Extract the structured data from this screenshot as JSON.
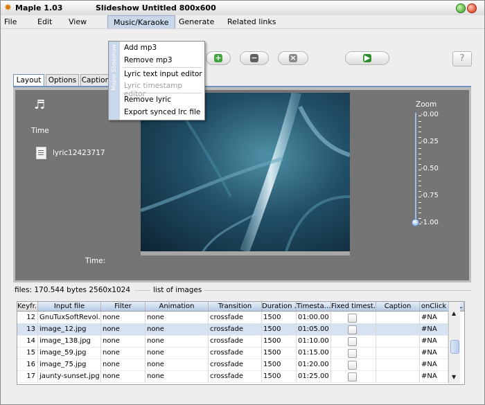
{
  "window": {
    "app_title": "Maple 1.03",
    "doc_title": "Slideshow Untitled 800x600"
  },
  "menubar": {
    "items": [
      {
        "label": "File"
      },
      {
        "label": "Edit"
      },
      {
        "label": "View"
      },
      {
        "label": "Music/Karaoke"
      },
      {
        "label": "Generate"
      },
      {
        "label": "Related links"
      }
    ]
  },
  "dropdown": {
    "side_label": "Maple Slideshow",
    "items": [
      {
        "label": "Add mp3",
        "enabled": true
      },
      {
        "label": "Remove mp3",
        "enabled": true
      },
      {
        "label": "Lyric text input editor",
        "enabled": true
      },
      {
        "label": "Lyric timestamp editor",
        "enabled": false
      },
      {
        "label": "Remove lyric",
        "enabled": true
      },
      {
        "label": "Export synced lrc file",
        "enabled": true
      }
    ]
  },
  "toolbar": {
    "help_icon": "?"
  },
  "tabs": [
    {
      "label": "Layout",
      "active": true
    },
    {
      "label": "Options",
      "active": false
    },
    {
      "label": "Caption",
      "active": false
    }
  ],
  "layout_panel": {
    "time_label": "Time",
    "lyric_file": "lyric12423717",
    "time_bottom_label": "Time:",
    "zoom": {
      "label": "Zoom",
      "ticks": [
        "-0.00",
        "-0.25",
        "-0.50",
        "-0.75",
        "-1.00"
      ],
      "value": 1.0
    }
  },
  "files": {
    "info": "files: 170.544 bytes 2560x1024",
    "list_label": "list of images"
  },
  "table": {
    "columns": [
      "Keyfr...",
      "Input file",
      "Filter",
      "Animation",
      "Transition",
      "Duration ...",
      "Timesta...",
      "Fixed timest...",
      "Caption",
      "onClick URL"
    ],
    "rows": [
      {
        "keyframe": "12",
        "file": "GnuTuxSoftRevol...",
        "filter": "none",
        "animation": "none",
        "transition": "crossfade",
        "duration": "1500",
        "timestamp": "01:00.00",
        "caption": "",
        "url": "#NA",
        "selected": false
      },
      {
        "keyframe": "13",
        "file": "image_12.jpg",
        "filter": "none",
        "animation": "none",
        "transition": "crossfade",
        "duration": "1500",
        "timestamp": "01:05.00",
        "caption": "",
        "url": "#NA",
        "selected": true
      },
      {
        "keyframe": "14",
        "file": "image_138.jpg",
        "filter": "none",
        "animation": "none",
        "transition": "crossfade",
        "duration": "1500",
        "timestamp": "01:10.00",
        "caption": "",
        "url": "#NA",
        "selected": false
      },
      {
        "keyframe": "15",
        "file": "image_59.jpg",
        "filter": "none",
        "animation": "none",
        "transition": "crossfade",
        "duration": "1500",
        "timestamp": "01:15.00",
        "caption": "",
        "url": "#NA",
        "selected": false
      },
      {
        "keyframe": "16",
        "file": "image_75.jpg",
        "filter": "none",
        "animation": "none",
        "transition": "crossfade",
        "duration": "1500",
        "timestamp": "01:20.00",
        "caption": "",
        "url": "#NA",
        "selected": false
      },
      {
        "keyframe": "17",
        "file": "jaunty-sunset.jpg",
        "filter": "none",
        "animation": "none",
        "transition": "crossfade",
        "duration": "1500",
        "timestamp": "01:25.00",
        "caption": "",
        "url": "#NA",
        "selected": false
      }
    ]
  },
  "colors": {
    "accent": "#6f8fbd",
    "menu_highlight": "#c9d7ea",
    "panel_bg": "#757575",
    "selected_row": "#d6e2f2"
  },
  "icons": {
    "app_icon": "maple-leaf-icon",
    "add": "plus-icon",
    "remove": "minus-icon",
    "clear": "x-icon",
    "play": "play-icon",
    "help": "help-icon",
    "note": "music-note-icon",
    "lyric": "document-icon"
  }
}
